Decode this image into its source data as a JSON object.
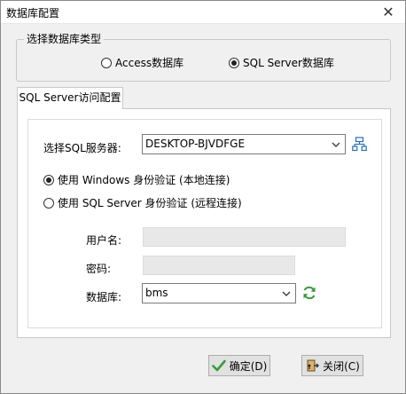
{
  "window": {
    "title": "数据库配置",
    "close_glyph": "✕"
  },
  "db_type_group": {
    "legend": "选择数据库类型",
    "options": [
      {
        "label": "Access数据库",
        "checked": false
      },
      {
        "label": "SQL Server数据库",
        "checked": true
      }
    ]
  },
  "tab": {
    "label": "SQL Server访问配置"
  },
  "server": {
    "label": "选择SQL服务器:",
    "value": "DESKTOP-BJVDFGE",
    "browse_icon": "network-servers-icon"
  },
  "auth": {
    "options": [
      {
        "label": "使用 Windows 身份验证  (本地连接)",
        "checked": true
      },
      {
        "label": "使用 SQL Server 身份验证 (远程连接)",
        "checked": false
      }
    ]
  },
  "username": {
    "label": "用户名:",
    "value": ""
  },
  "password": {
    "label": "密码:",
    "value": ""
  },
  "database": {
    "label": "数据库:",
    "value": "bms",
    "refresh_icon": "refresh-icon"
  },
  "buttons": {
    "ok": {
      "label": "确定(D)",
      "icon": "checkmark-icon"
    },
    "close": {
      "label": "关闭(C)",
      "icon": "close-door-icon"
    }
  },
  "colors": {
    "accent_green": "#3a9a3a",
    "network_icon_blue": "#2a6fb0",
    "disabled_input_bg": "#e8e8e8"
  }
}
